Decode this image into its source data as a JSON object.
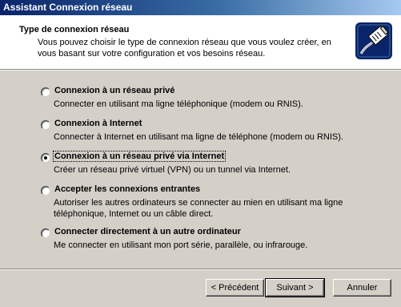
{
  "window": {
    "title": "Assistant Connexion réseau"
  },
  "header": {
    "title": "Type de connexion réseau",
    "subtitle": "Vous pouvez choisir le type de connexion réseau que vous voulez créer, en vous basant sur votre configuration et vos besoins réseau."
  },
  "options": [
    {
      "label": "Connexion à un réseau privé",
      "description": "Connecter en utilisant ma ligne téléphonique (modem ou RNIS).",
      "selected": false
    },
    {
      "label": "Connexion à Internet",
      "description": "Connecter à Internet en utilisant ma ligne de téléphone (modem ou RNIS).",
      "selected": false
    },
    {
      "label": "Connexion à un réseau privé via Internet",
      "description": "Créer un réseau privé virtuel (VPN) ou un tunnel via Internet.",
      "selected": true
    },
    {
      "label": "Accepter les connexions entrantes",
      "description": "Autoriser les autres ordinateurs se connecter au mien en utilisant ma ligne téléphonique, Internet ou un câble direct.",
      "selected": false
    },
    {
      "label": "Connecter directement à un autre ordinateur",
      "description": "Me connecter en utilisant mon port série, parallèle, ou infrarouge.",
      "selected": false
    }
  ],
  "buttons": {
    "back": "< Précédent",
    "next": "Suivant >",
    "cancel": "Annuler"
  },
  "icons": {
    "header": "network-cable-icon"
  }
}
